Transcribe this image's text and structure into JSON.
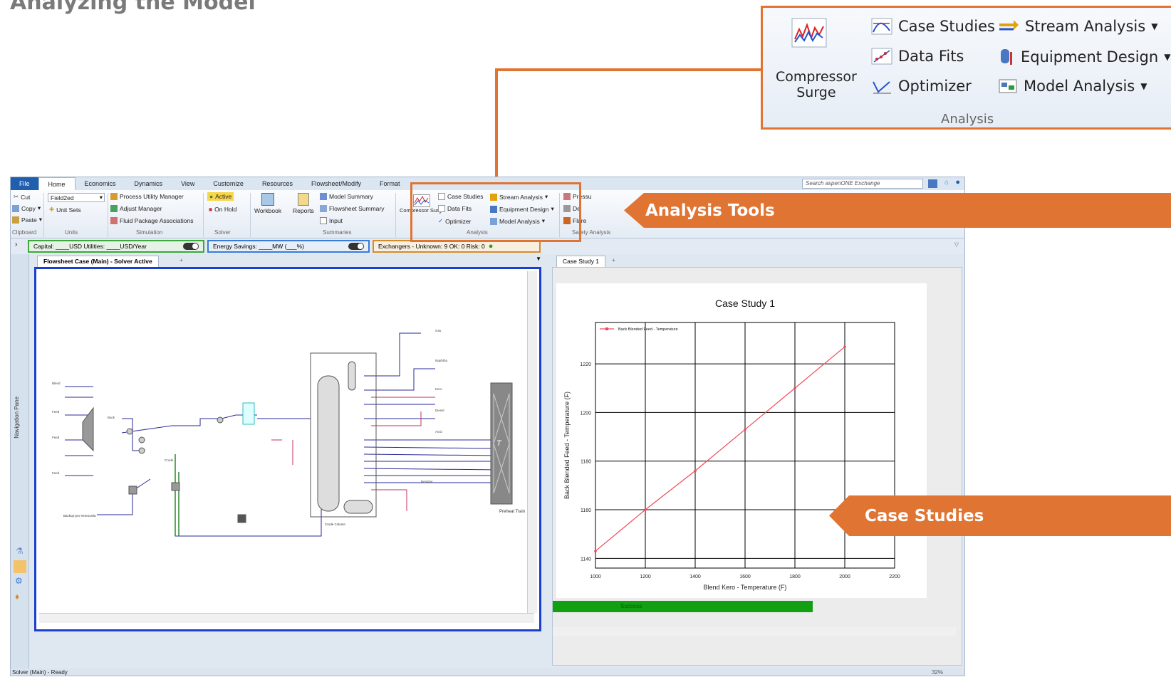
{
  "slide": {
    "title": "Analyzing the Model"
  },
  "zoom": {
    "compressor_surge_line1": "Compressor",
    "compressor_surge_line2": "Surge",
    "case_studies": "Case Studies",
    "data_fits": "Data Fits",
    "optimizer": "Optimizer",
    "stream_analysis": "Stream Analysis",
    "equipment_design": "Equipment Design",
    "model_analysis": "Model Analysis",
    "group_label": "Analysis"
  },
  "callouts": {
    "analysis_tools": "Analysis Tools",
    "case_studies": "Case Studies"
  },
  "app": {
    "menu_tabs": [
      "File",
      "Home",
      "Economics",
      "Dynamics",
      "View",
      "Customize",
      "Resources",
      "Flowsheet/Modify",
      "Format"
    ],
    "search_placeholder": "Search aspenONE Exchange",
    "ribbon": {
      "cut": "Cut",
      "copy": "Copy",
      "paste": "Paste",
      "clipboard": "Clipboard",
      "unit_set_value": "Field2ed",
      "unit_sets": "Unit Sets",
      "units": "Units",
      "process_utility_manager": "Process Utility Manager",
      "adjust_manager": "Adjust Manager",
      "fluid_package_associations": "Fluid Package Associations",
      "simulation": "Simulation",
      "active": "Active",
      "on_hold": "On Hold",
      "solver": "Solver",
      "workbook": "Workbook",
      "reports": "Reports",
      "model_summary": "Model Summary",
      "flowsheet_summary": "Flowsheet Summary",
      "input": "Input",
      "summaries": "Summaries",
      "compressor_surge": "Compressor Surge",
      "case_studies": "Case Studies",
      "data_fits": "Data Fits",
      "optimizer": "Optimizer",
      "stream_analysis": "Stream Analysis",
      "equipment_design": "Equipment Design",
      "model_analysis": "Model Analysis",
      "analysis": "Analysis",
      "pressure": "Pressu",
      "de": "De",
      "flare": "Flare",
      "safety_analysis": "Safety Analysis"
    },
    "status": {
      "capital": "Capital: ____USD  Utilities: ____USD/Year",
      "energy": "Energy Savings: ____MW  (___%)",
      "exchangers": "Exchangers - Unknown: 9   OK: 0   Risk: 0"
    },
    "nav_label": "Navigation Pane",
    "flowsheet_tab": "Flowsheet Case (Main) - Solver Active",
    "case_tab": "Case Study 1",
    "progress_label": "Success",
    "statusbar": "Solver (Main) - Ready",
    "zoom_level": "32%",
    "flowsheet_labels": {
      "preheat": "Preheat Train",
      "tag": "T",
      "crude_column": "Crude Column",
      "backup": "Backup-pro-Venezuela"
    }
  },
  "chart_data": {
    "type": "line",
    "title": "Case Study 1",
    "xlabel": "Blend Kero - Temperature (F)",
    "ylabel": "Back Blended Feed - Temperature (F)",
    "xlim": [
      1000,
      2200
    ],
    "ylim": [
      1136,
      1237
    ],
    "xticks": [
      1000,
      1200,
      1400,
      1600,
      1800,
      2000,
      2200
    ],
    "yticks": [
      1140,
      1160,
      1180,
      1200,
      1220
    ],
    "grid": true,
    "legend": "top-left",
    "series": [
      {
        "name": "Back Blended Feed - Temperature",
        "color": "#f04a5a",
        "x": [
          1000,
          1200,
          1400,
          1600,
          1800,
          2000
        ],
        "y": [
          1143,
          1160,
          1176,
          1193,
          1210,
          1227
        ]
      }
    ]
  }
}
